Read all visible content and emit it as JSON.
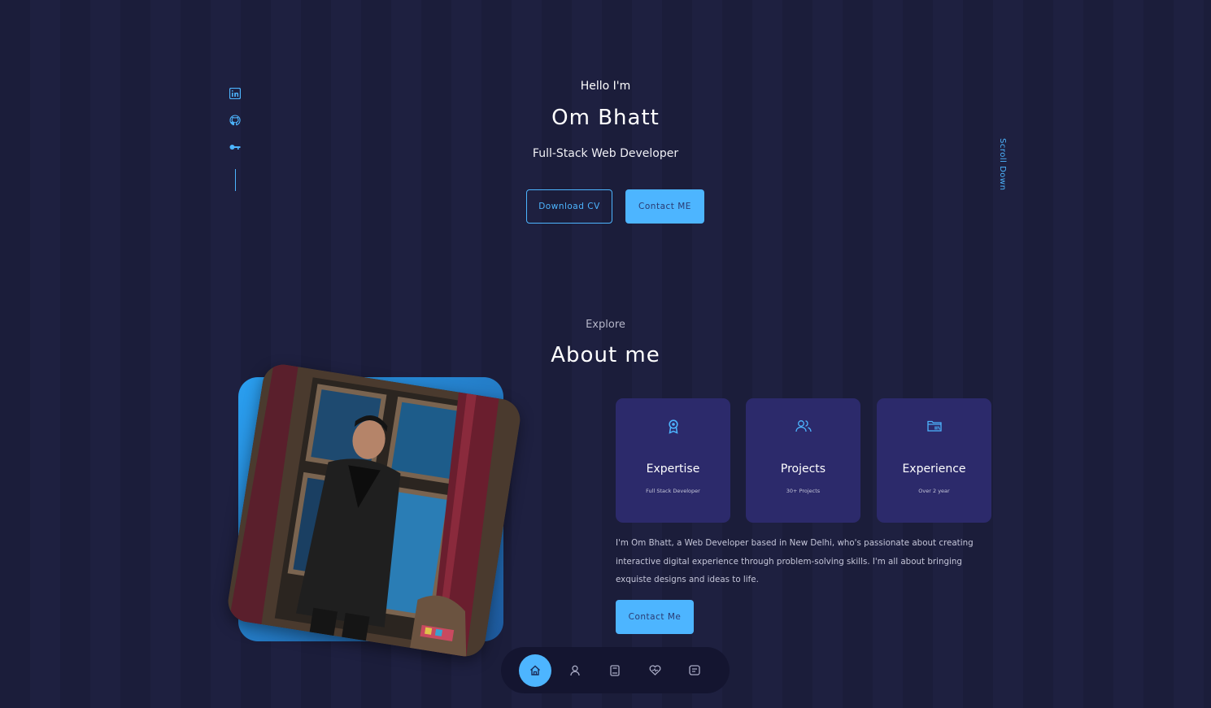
{
  "socials": [
    {
      "icon": "linkedin-icon"
    },
    {
      "icon": "github-icon"
    },
    {
      "icon": "key-icon"
    }
  ],
  "hero": {
    "greeting": "Hello I'm",
    "name": "Om Bhatt",
    "role": "Full-Stack Web Developer",
    "download_cv_label": "Download CV",
    "contact_label": "Contact ME",
    "scroll_down": "Scroll Down"
  },
  "about": {
    "eyebrow": "Explore",
    "title": "About me",
    "cards": [
      {
        "icon": "award-icon",
        "title": "Expertise",
        "subtitle": "Full Stack Developer"
      },
      {
        "icon": "users-icon",
        "title": "Projects",
        "subtitle": "30+ Projects"
      },
      {
        "icon": "folder-icon",
        "title": "Experience",
        "subtitle": "Over 2 year"
      }
    ],
    "text": "I'm Om Bhatt, a Web Developer based in New Delhi, who's passionate about creating interactive digital experience through problem-solving skills. I'm all about bringing exquiste designs and ideas to life.",
    "contact_label": "Contact Me"
  },
  "nav": {
    "items": [
      {
        "icon": "home-icon",
        "active": true
      },
      {
        "icon": "user-icon",
        "active": false
      },
      {
        "icon": "book-icon",
        "active": false
      },
      {
        "icon": "heart-icon",
        "active": false
      },
      {
        "icon": "message-icon",
        "active": false
      }
    ]
  },
  "colors": {
    "background": "#1b1d3a",
    "accent": "#4db5ff",
    "card": "#2c2a6b",
    "nav": "#141530"
  }
}
